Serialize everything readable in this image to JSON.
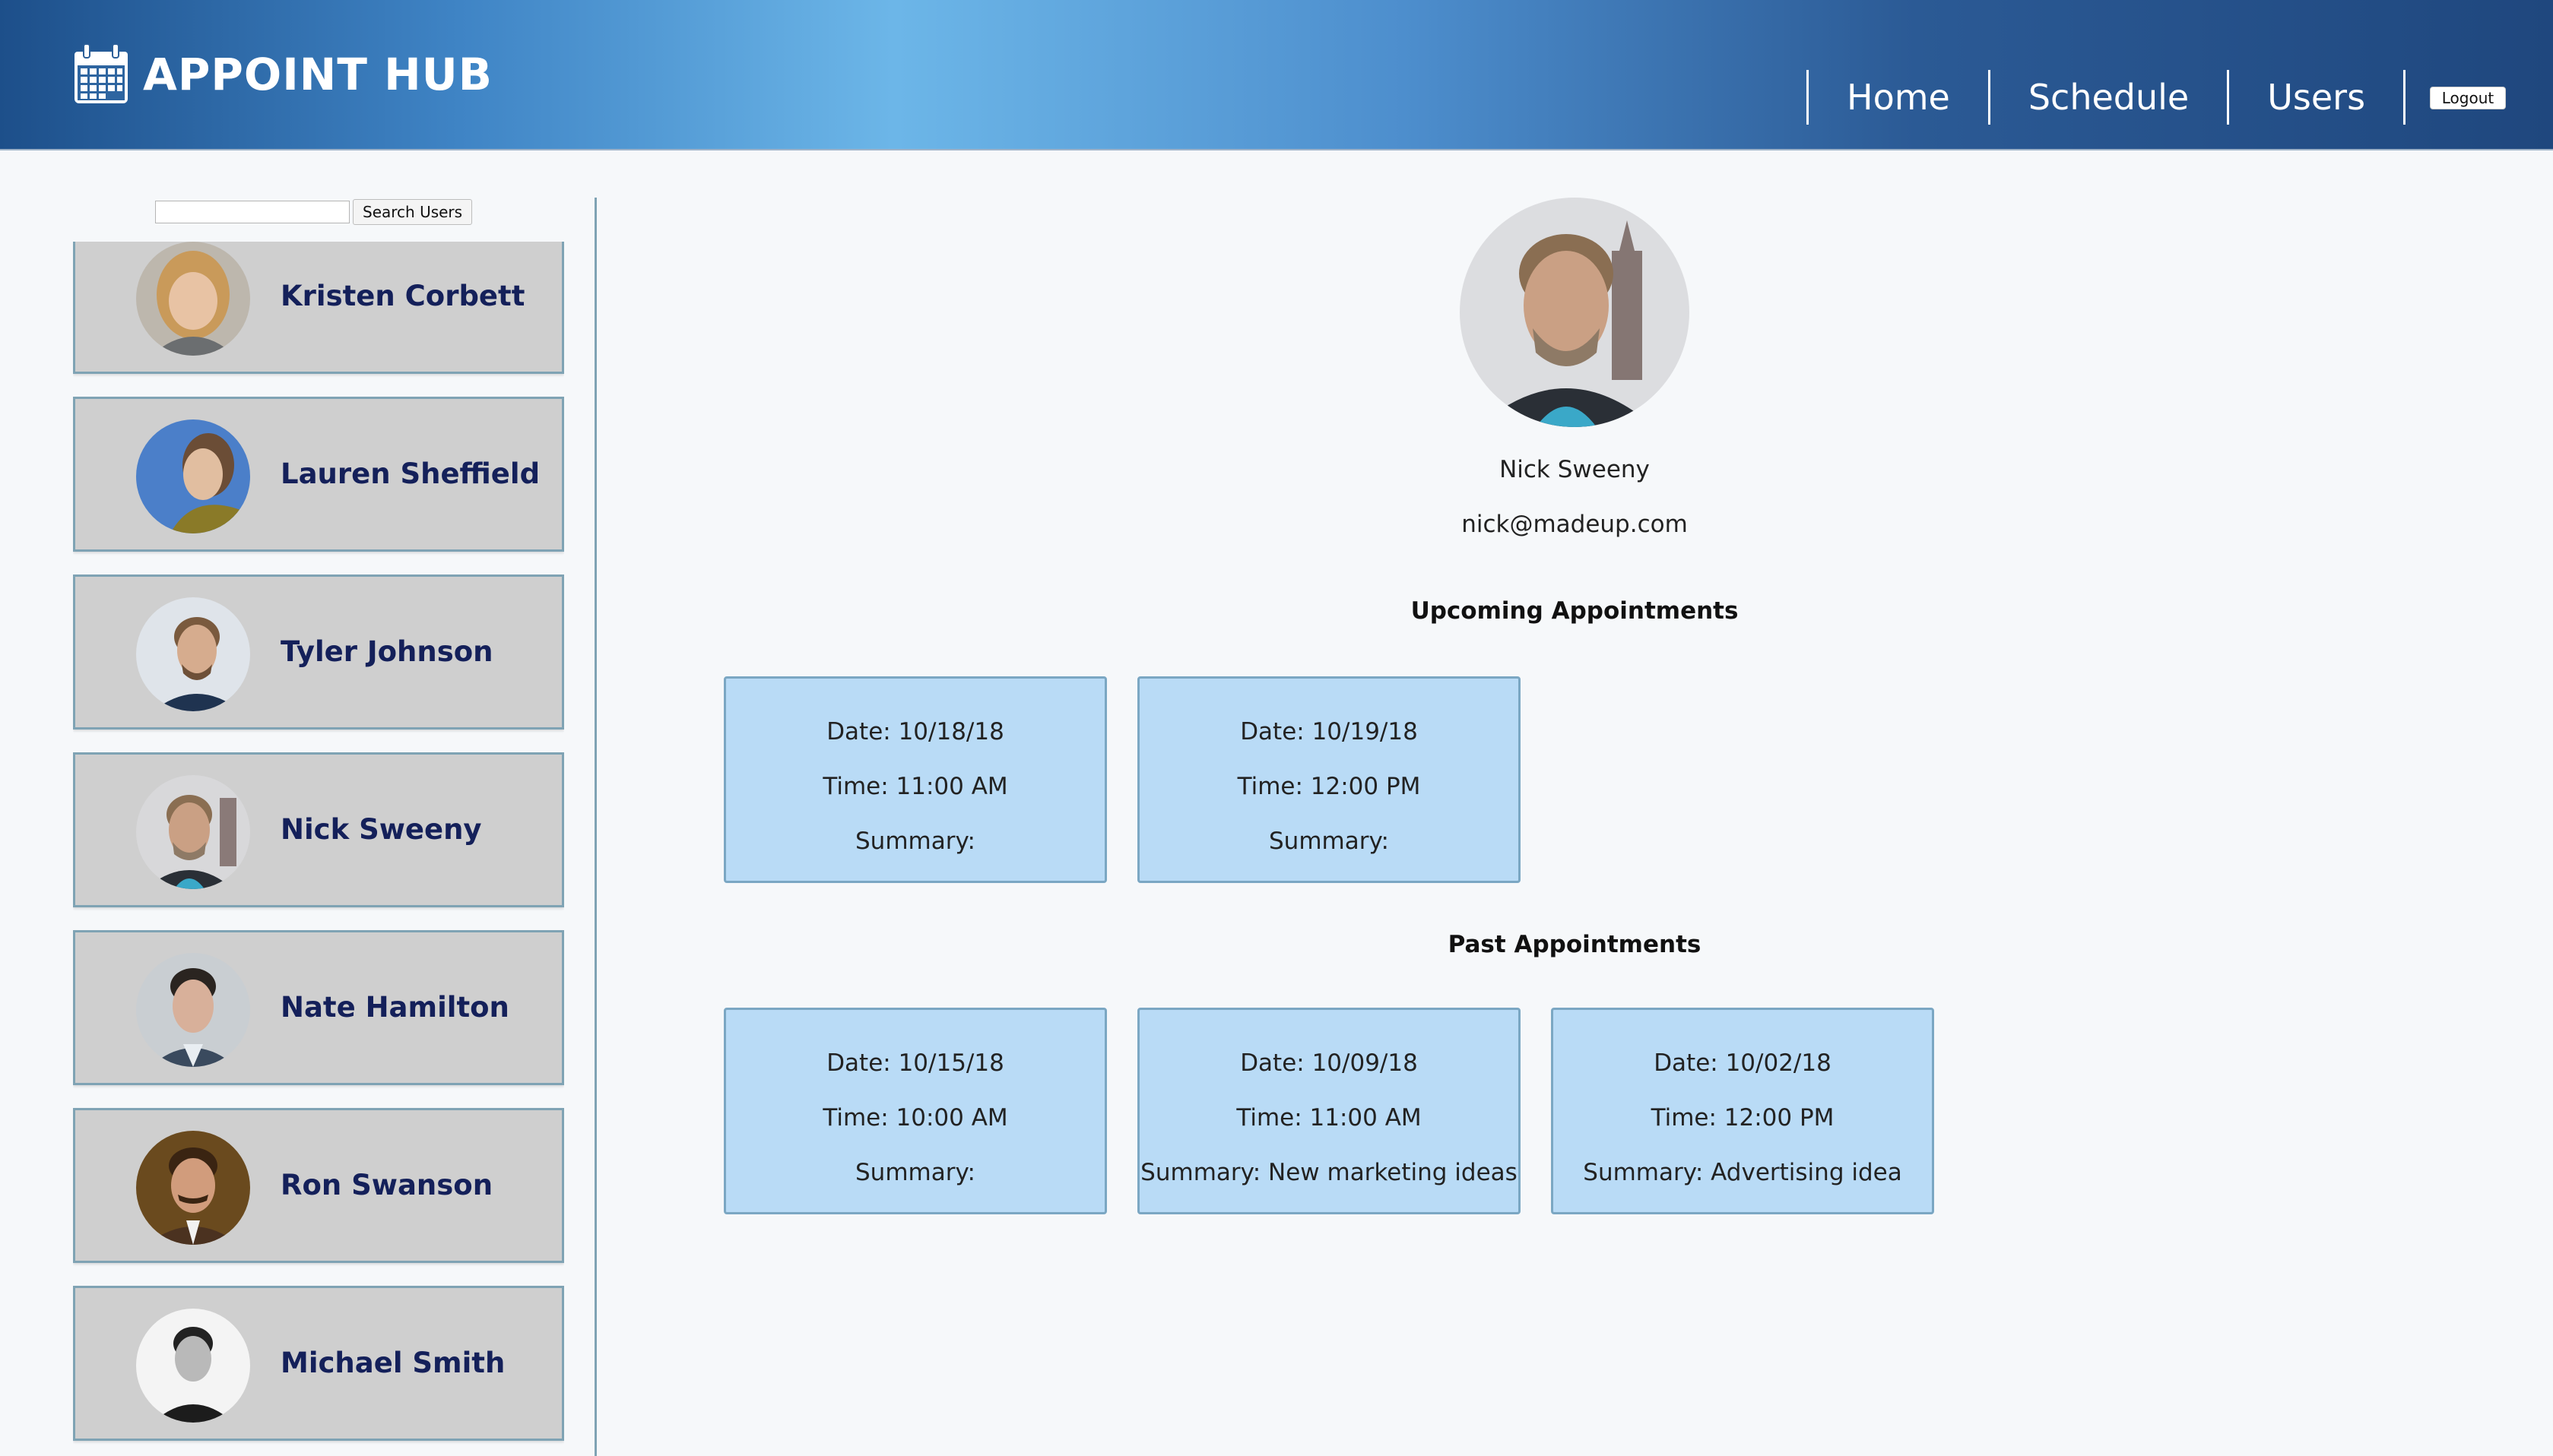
{
  "header": {
    "title": "APPOINT HUB",
    "nav": [
      "Home",
      "Schedule",
      "Users"
    ],
    "logout_label": "Logout"
  },
  "search": {
    "value": "",
    "button_label": "Search Users"
  },
  "users": [
    {
      "name": "Kristen Corbett"
    },
    {
      "name": "Lauren Sheffield"
    },
    {
      "name": "Tyler Johnson"
    },
    {
      "name": "Nick Sweeny"
    },
    {
      "name": "Nate Hamilton"
    },
    {
      "name": "Ron Swanson"
    },
    {
      "name": "Michael Smith"
    }
  ],
  "profile": {
    "name": "Nick Sweeny",
    "email": "nick@madeup.com"
  },
  "upcoming": {
    "title": "Upcoming Appointments",
    "items": [
      {
        "date": "Date: 10/18/18",
        "time": "Time: 11:00 AM",
        "summary": "Summary:"
      },
      {
        "date": "Date: 10/19/18",
        "time": "Time: 12:00 PM",
        "summary": "Summary:"
      }
    ]
  },
  "past": {
    "title": "Past Appointments",
    "items": [
      {
        "date": "Date: 10/15/18",
        "time": "Time: 10:00 AM",
        "summary": "Summary:"
      },
      {
        "date": "Date: 10/09/18",
        "time": "Time: 11:00 AM",
        "summary": "Summary: New marketing ideas"
      },
      {
        "date": "Date: 10/02/18",
        "time": "Time: 12:00 PM",
        "summary": "Summary: Advertising idea"
      }
    ]
  },
  "colors": {
    "header_dark": "#1d4f8a",
    "header_light": "#6cb6e8",
    "user_card_bg": "#cfcfcf",
    "user_name": "#14205a",
    "appt_card_bg": "#b9dbf6",
    "appt_card_border": "#7ba7c3"
  },
  "icons": {
    "brand": "calendar-icon"
  }
}
